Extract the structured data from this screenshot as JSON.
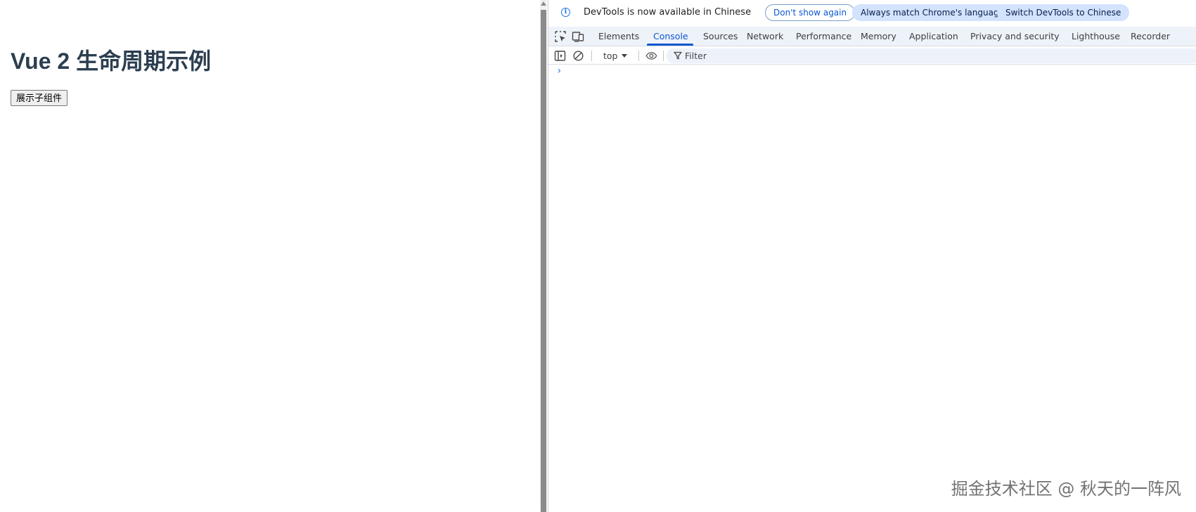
{
  "page": {
    "title": "Vue 2 生命周期示例",
    "button_label": "展示子组件"
  },
  "devtools": {
    "infobar": {
      "message": "DevTools is now available in Chinese",
      "dont_show_again": "Don't show again",
      "always_match": "Always match Chrome's language",
      "switch_language": "Switch DevTools to Chinese"
    },
    "tabs": [
      {
        "label": "Elements"
      },
      {
        "label": "Console"
      },
      {
        "label": "Sources"
      },
      {
        "label": "Network"
      },
      {
        "label": "Performance"
      },
      {
        "label": "Memory"
      },
      {
        "label": "Application"
      },
      {
        "label": "Privacy and security"
      },
      {
        "label": "Lighthouse"
      },
      {
        "label": "Recorder"
      }
    ],
    "active_tab": "Console",
    "toolbar": {
      "context": "top",
      "filter_placeholder": "Filter"
    },
    "console": {
      "prompt": "›"
    },
    "icons": {
      "inspect": "inspect-element-icon",
      "device": "device-toolbar-icon",
      "sidebar": "sidebar-toggle-icon",
      "clear": "clear-console-icon",
      "eye": "live-expression-eye-icon",
      "filter": "filter-funnel-icon",
      "info": "info-icon"
    },
    "colors": {
      "accent": "#0b57d0",
      "tab_bar_bg": "#eef2f9",
      "pill_bg": "#d3e3fd"
    }
  },
  "watermark": "掘金技术社区 @ 秋天的一阵风"
}
